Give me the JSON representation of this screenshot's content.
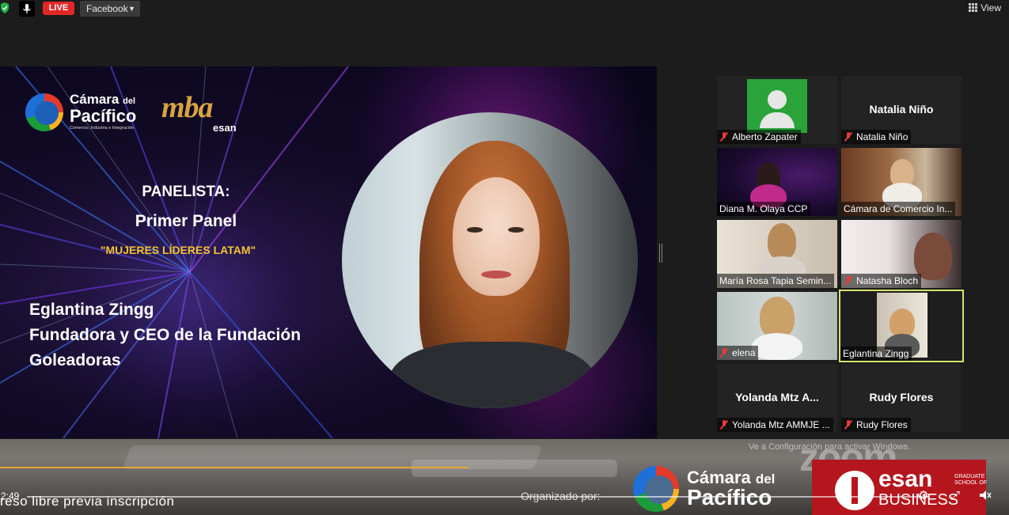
{
  "topbar": {
    "live_label": "LIVE",
    "platform_label": "Facebook",
    "view_label": "View"
  },
  "slide": {
    "brand_ccp_line1": "Cámara",
    "brand_ccp_line1b": "del",
    "brand_ccp_line2": "Pacífico",
    "brand_ccp_line3": "Comercio, Industria e Integración",
    "brand_mba": "mba",
    "brand_esan": "esan",
    "panelista": "PANELISTA:",
    "panel": "Primer Panel",
    "panel_theme": "\"MUJERES LÍDERES LATAM\"",
    "speaker_name": "Eglantina Zingg",
    "speaker_role_line1": "Fundadora y CEO de la Fundación",
    "speaker_role_line2": "Goleadoras"
  },
  "gallery": {
    "tiles": [
      {
        "name": "Alberto Zapater",
        "big": ""
      },
      {
        "name": "Natalia Niño",
        "big": "Natalia Niño"
      },
      {
        "name": "Diana M. Olaya CCP",
        "big": ""
      },
      {
        "name": "Cámara de Comercio In...",
        "big": ""
      },
      {
        "name": "María Rosa Tapia Semin...",
        "big": ""
      },
      {
        "name": "Natasha Bloch",
        "big": ""
      },
      {
        "name": "elena",
        "big": ""
      },
      {
        "name": "Eglantina Zingg",
        "big": ""
      },
      {
        "name": "Yolanda Mtz AMMJE ...",
        "big": "Yolanda Mtz A..."
      },
      {
        "name": "Rudy Flores",
        "big": "Rudy Flores"
      }
    ]
  },
  "bottom": {
    "time": "2:49",
    "ingreso": "reso libre previa inscripción",
    "organizado": "Organizado por:",
    "ve_text": "Ve a Configuración para activar Windows.",
    "ccp_line1": "Cámara",
    "ccp_line1b": "del",
    "ccp_line2": "Pacífico",
    "esan": "esan",
    "business": "BUSINESS",
    "graduate": "GRADUATE SCHOOL OF",
    "zoom": "zoom"
  }
}
